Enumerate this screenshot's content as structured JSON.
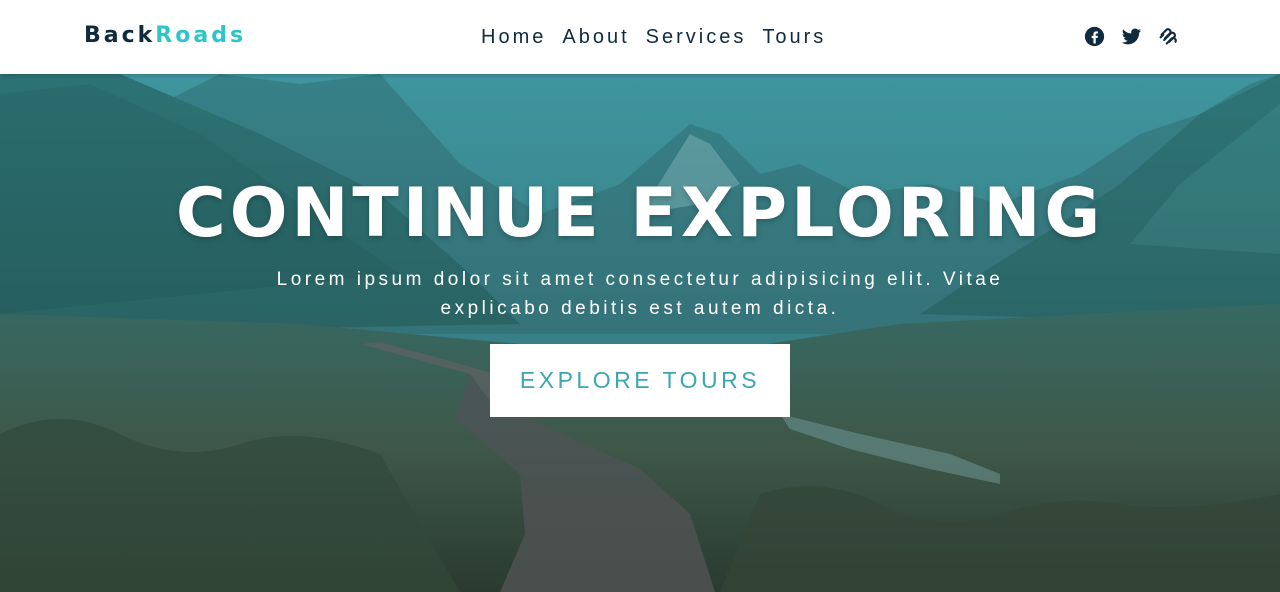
{
  "brand": {
    "part1": "Back",
    "part2": "Roads",
    "accent_color": "#2ec5c8",
    "text_color": "#102a3e"
  },
  "nav": {
    "links": [
      "Home",
      "About",
      "Services",
      "Tours"
    ]
  },
  "social": {
    "icons": [
      "facebook-icon",
      "twitter-icon",
      "squarespace-icon"
    ]
  },
  "hero": {
    "title": "CONTINUE EXPLORING",
    "subtitle_line1": "Lorem ipsum dolor sit amet consectetur adipisicing elit. Vitae",
    "subtitle_line2": "explicabo debitis est autem dicta.",
    "button_label": "EXPLORE TOURS",
    "overlay_color": "#2a8c95"
  }
}
